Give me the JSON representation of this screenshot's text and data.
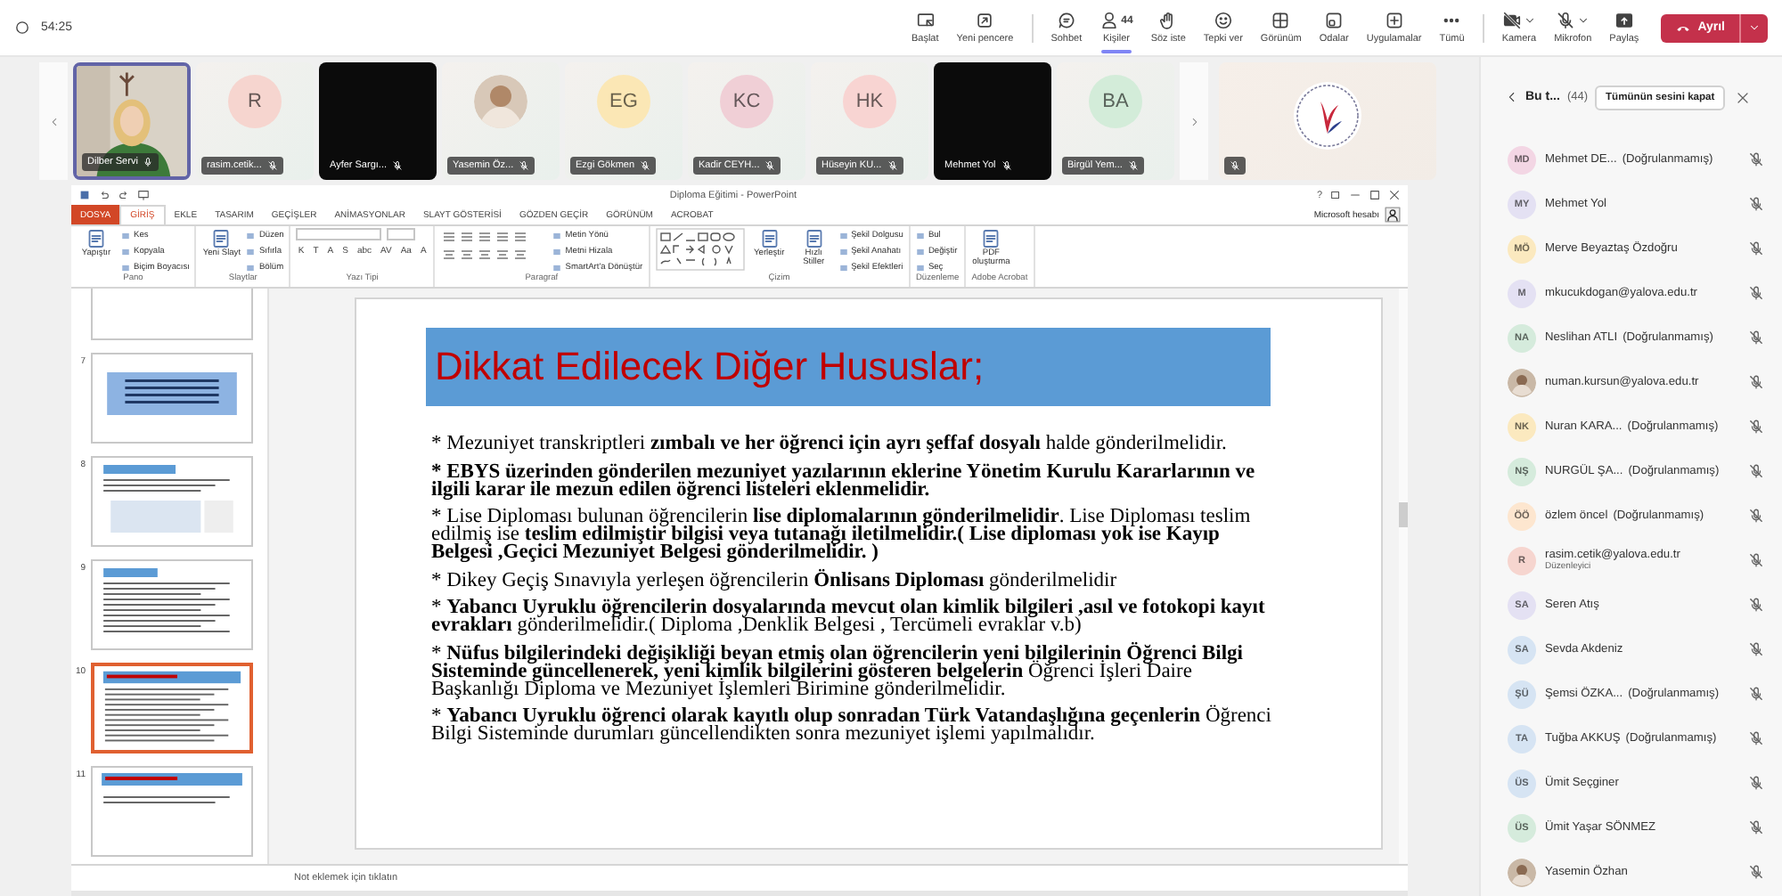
{
  "meeting": {
    "timer": "54:25"
  },
  "toolbar": {
    "groups": [
      [
        {
          "label": "Başlat",
          "selected": false
        },
        {
          "label": "Yeni pencere",
          "selected": false
        }
      ],
      [
        {
          "label": "Sohbet",
          "selected": false
        },
        {
          "label": "Kişiler",
          "count": "44",
          "selected": true
        },
        {
          "label": "Söz iste",
          "selected": false
        },
        {
          "label": "Tepki ver",
          "selected": false
        },
        {
          "label": "Görünüm",
          "selected": false
        },
        {
          "label": "Odalar",
          "selected": false
        },
        {
          "label": "Uygulamalar",
          "selected": false
        },
        {
          "label": "Tümü",
          "selected": false
        }
      ],
      [
        {
          "label": "Kamera",
          "selected": false,
          "off": true
        },
        {
          "label": "Mikrofon",
          "selected": false,
          "off": true
        },
        {
          "label": "Paylaş",
          "selected": false
        }
      ]
    ],
    "leave": {
      "label": "Ayrıl"
    }
  },
  "participants_strip": [
    {
      "kind": "video",
      "name": "Dilber Servi",
      "speaking": true,
      "muted": false
    },
    {
      "kind": "initials",
      "initials": "R",
      "name": "rasim.cetik...",
      "color": "#f6d5cf",
      "speaking": false,
      "muted": true
    },
    {
      "kind": "dark",
      "name": "Ayfer Sargı...",
      "speaking": false,
      "muted": true
    },
    {
      "name": "Yasemin Öz...",
      "speaking": false,
      "muted": true
    },
    {
      "kind": "initials",
      "initials": "EG",
      "name": "Ezgi Gökmen",
      "color": "#fbe7b5",
      "speaking": false,
      "muted": true
    },
    {
      "kind": "initials",
      "initials": "KC",
      "name": "Kadir CEYH...",
      "color": "#f0cfd6",
      "speaking": false,
      "muted": true
    },
    {
      "kind": "initials",
      "initials": "HK",
      "name": "Hüseyin KU...",
      "color": "#f8d4d2",
      "speaking": false,
      "muted": true
    },
    {
      "kind": "dark",
      "name": "Mehmet Yol",
      "speaking": false,
      "muted": true
    },
    {
      "kind": "initials",
      "initials": "BA",
      "name": "Birgül Yem...",
      "color": "#d3ecd9",
      "speaking": false,
      "muted": true
    },
    {
      "kind": "logo",
      "speaking": false,
      "muted": true
    }
  ],
  "powerpoint": {
    "title": "Diploma Eğitimi - PowerPoint",
    "help": "?",
    "account": "Microsoft hesabı",
    "tabs": [
      {
        "label": "DOSYA",
        "kind": "file",
        "selected": false
      },
      {
        "label": "GİRİŞ",
        "kind": "tab",
        "selected": true
      },
      {
        "label": "EKLE",
        "kind": "tab",
        "selected": false
      },
      {
        "label": "TASARIM",
        "kind": "tab",
        "selected": false
      },
      {
        "label": "GEÇİŞLER",
        "kind": "tab",
        "selected": false
      },
      {
        "label": "ANİMASYONLAR",
        "kind": "tab",
        "selected": false
      },
      {
        "label": "SLAYT GÖSTERİSİ",
        "kind": "tab",
        "selected": false
      },
      {
        "label": "GÖZDEN GEÇİR",
        "kind": "tab",
        "selected": false
      },
      {
        "label": "GÖRÜNÜM",
        "kind": "tab",
        "selected": false
      },
      {
        "label": "ACROBAT",
        "kind": "tab",
        "selected": false
      }
    ],
    "ribbon": [
      {
        "label": "Pano",
        "columns": [
          {
            "kind": "large",
            "label": "Yapıştır"
          },
          {
            "kind": "stack",
            "items": [
              "Kes",
              "Kopyala",
              "Biçim Boyacısı"
            ]
          }
        ]
      },
      {
        "label": "Slaytlar",
        "columns": [
          {
            "kind": "large",
            "label": "Yeni Slayt"
          },
          {
            "kind": "stack",
            "items": [
              "Düzen",
              "Sıfırla",
              "Bölüm"
            ]
          }
        ]
      },
      {
        "label": "Yazı Tipi",
        "columns": [
          {
            "kind": "font",
            "glyphs": [
              "K",
              "T",
              "A",
              "S",
              "abc",
              "AV",
              "Aa",
              "A"
            ]
          }
        ]
      },
      {
        "label": "Paragraf",
        "columns": [
          {
            "kind": "align"
          },
          {
            "kind": "stack",
            "items": [
              "Metin Yönü",
              "Metni Hizala",
              "SmartArt'a Dönüştür"
            ]
          }
        ]
      },
      {
        "label": "Çizim",
        "columns": [
          {
            "kind": "shapes"
          },
          {
            "kind": "large",
            "label": "Yerleştir"
          },
          {
            "kind": "large",
            "label": "Hızlı Stiller"
          },
          {
            "kind": "stack",
            "items": [
              "Şekil Dolgusu",
              "Şekil Anahatı",
              "Şekil Efektleri"
            ]
          }
        ]
      },
      {
        "label": "Düzenleme",
        "columns": [
          {
            "kind": "stack",
            "items": [
              "Bul",
              "Değiştir",
              "Seç"
            ]
          }
        ]
      },
      {
        "label": "Adobe Acrobat",
        "columns": [
          {
            "kind": "large",
            "label": "PDF oluşturma"
          }
        ]
      }
    ],
    "thumbnails": [
      {
        "kind": "partial",
        "selected": false
      },
      {
        "kind": "numbered",
        "number": "7",
        "selected": false
      },
      {
        "kind": "numbered",
        "number": "8",
        "selected": false
      },
      {
        "kind": "numbered",
        "number": "9",
        "selected": false
      },
      {
        "kind": "numbered",
        "number": "10",
        "selected": true
      },
      {
        "kind": "numbered",
        "number": "11",
        "selected": false
      }
    ],
    "slide": {
      "title": "Dikkat Edilecek Diğer Hususlar;",
      "paragraphs": [
        {
          "marker": "*",
          "bold": false,
          "text": "Mezuniyet  transkriptleri **zımbalı ve her öğrenci için ayrı  şeffaf dosyalı** halde gönderilmelidir."
        },
        {
          "marker": "*",
          "bold": true,
          "text": "EBYS üzerinden gönderilen mezuniyet yazılarının eklerine Yönetim Kurulu Kararlarının ve ilgili karar ile mezun edilen öğrenci listeleri eklenmelidir."
        },
        {
          "marker": "*",
          "bold": false,
          "text": "Lise Diploması bulunan öğrencilerin **lise diplomalarının gönderilmelidir**. Lise Diploması teslim edilmiş ise **teslim edilmiştir bilgisi veya tutanağı iletilmelidir.( Lise diploması yok ise Kayıp Belgesi ,Geçici Mezuniyet Belgesi gönderilmelidir. )**"
        },
        {
          "marker": "*",
          "bold": false,
          "text": "Dikey Geçiş Sınavıyla yerleşen öğrencilerin  **Önlisans Diploması** gönderilmelidir"
        },
        {
          "marker": "*",
          "bold": false,
          "text": "**Yabancı Uyruklu öğrencilerin dosyalarında mevcut olan kimlik bilgileri ,asıl ve fotokopi kayıt evrakları** gönderilmelidir.( Diploma ,Denklik Belgesi , Tercümeli evraklar v.b)"
        },
        {
          "marker": "*",
          "bold": false,
          "text": "**Nüfus bilgilerindeki değişikliği beyan etmiş olan öğrencilerin yeni bilgilerinin Öğrenci Bilgi Sisteminde güncellenerek, yeni kimlik bilgilerini gösteren belgelerin** Öğrenci İşleri Daire Başkanlığı Diploma ve Mezuniyet İşlemleri Birimine gönderilmelidir."
        },
        {
          "marker": "*",
          "bold": false,
          "text": "**Yabancı Uyruklu öğrenci olarak kayıtlı olup sonradan Türk Vatandaşlığına geçenlerin** Öğrenci Bilgi Sisteminde durumları güncellendikten sonra mezuniyet işlemi yapılmalıdır."
        }
      ]
    },
    "notes_placeholder": "Not eklemek için tıklatın"
  },
  "panel": {
    "title": "Bu t...",
    "count": "(44)",
    "mute_all": "Tümünün sesini kapat",
    "people": [
      {
        "kind": "initials",
        "initials": "MD",
        "name": "Mehmet DE...",
        "note": "(Doğrulanmamış)",
        "color": "#f3d6e4",
        "muted": true
      },
      {
        "kind": "initials",
        "initials": "MY",
        "name": "Mehmet Yol",
        "color": "#e4e1f3",
        "muted": true
      },
      {
        "kind": "initials",
        "initials": "MÖ",
        "name": "Merve Beyaztaş Özdoğru",
        "color": "#fbe9bf",
        "muted": true
      },
      {
        "kind": "initials",
        "initials": "M",
        "name": "mkucukdogan@yalova.edu.tr",
        "color": "#e4e1f3",
        "muted": true
      },
      {
        "kind": "initials",
        "initials": "NA",
        "name": "Neslihan ATLI",
        "note": "(Doğrulanmamış)",
        "color": "#d5ebdc",
        "muted": true
      },
      {
        "name": "numan.kursun@yalova.edu.tr",
        "muted": true
      },
      {
        "kind": "initials",
        "initials": "NK",
        "name": "Nuran KARA...",
        "note": "(Doğrulanmamış)",
        "color": "#fbe9bf",
        "muted": true
      },
      {
        "kind": "initials",
        "initials": "NŞ",
        "name": "NURGÜL ŞA...",
        "note": "(Doğrulanmamış)",
        "color": "#d5ebdc",
        "muted": true
      },
      {
        "kind": "initials",
        "initials": "ÖÖ",
        "name": "özlem öncel",
        "note": "(Doğrulanmamış)",
        "color": "#fde6cf",
        "muted": true
      },
      {
        "kind": "initials",
        "initials": "R",
        "name": "rasim.cetik@yalova.edu.tr",
        "role": "Düzenleyici",
        "color": "#f6d5cf",
        "muted": true
      },
      {
        "kind": "initials",
        "initials": "SA",
        "name": "Seren Atış",
        "color": "#e4e1f3",
        "muted": true
      },
      {
        "kind": "initials",
        "initials": "SA",
        "name": "Sevda Akdeniz",
        "color": "#d6e4f3",
        "muted": true
      },
      {
        "kind": "initials",
        "initials": "ŞÜ",
        "name": "Şemsi ÖZKA...",
        "note": "(Doğrulanmamış)",
        "color": "#d6e4f3",
        "muted": true
      },
      {
        "kind": "initials",
        "initials": "TA",
        "name": "Tuğba AKKUŞ",
        "note": "(Doğrulanmamış)",
        "color": "#d6e4f3",
        "muted": true
      },
      {
        "kind": "initials",
        "initials": "ÜS",
        "name": "Ümit Seçginer",
        "color": "#d6e4f3",
        "muted": true
      },
      {
        "kind": "initials",
        "initials": "ÜS",
        "name": "Ümit Yaşar SÖNMEZ",
        "color": "#d5ebdc",
        "muted": true
      },
      {
        "name": "Yasemin Özhan",
        "muted": true
      }
    ]
  }
}
